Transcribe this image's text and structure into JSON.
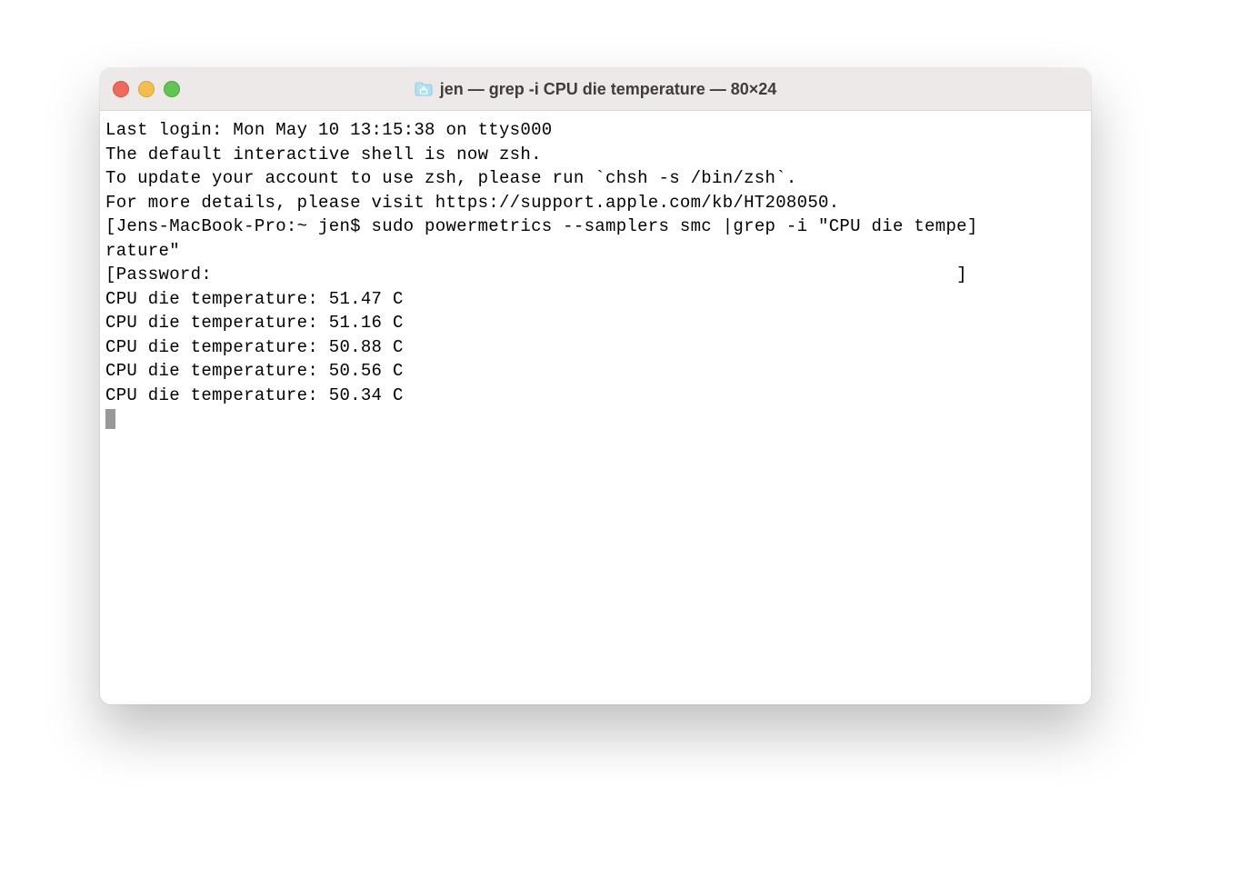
{
  "window": {
    "title": "jen — grep -i CPU die temperature — 80×24"
  },
  "terminal": {
    "last_login": "Last login: Mon May 10 13:15:38 on ttys000",
    "blank1": "",
    "shell_notice_1": "The default interactive shell is now zsh.",
    "shell_notice_2": "To update your account to use zsh, please run `chsh -s /bin/zsh`.",
    "shell_notice_3": "For more details, please visit https://support.apple.com/kb/HT208050.",
    "prompt_line_1": "Jens-MacBook-Pro:~ jen$ sudo powermetrics --samplers smc |grep -i \"CPU die tempe",
    "prompt_line_2": "rature\"",
    "password_prompt": "Password:",
    "output": [
      "CPU die temperature: 51.47 C",
      "CPU die temperature: 51.16 C",
      "CPU die temperature: 50.88 C",
      "CPU die temperature: 50.56 C",
      "CPU die temperature: 50.34 C"
    ]
  }
}
